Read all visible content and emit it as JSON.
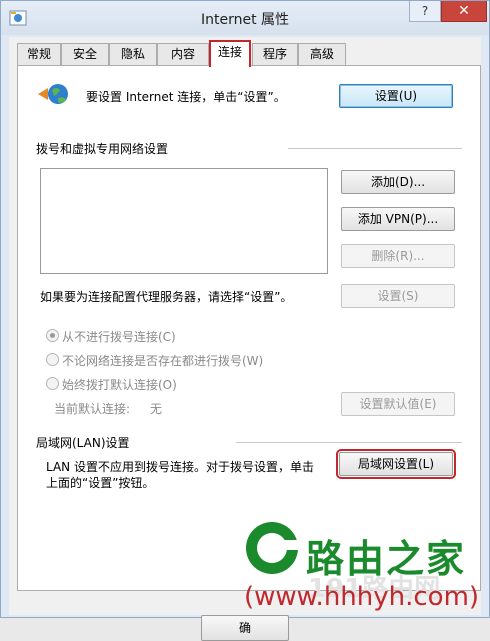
{
  "window": {
    "title": "Internet 属性",
    "help_glyph": "?",
    "close_glyph": "✕"
  },
  "tabs": [
    {
      "label": "常规"
    },
    {
      "label": "安全"
    },
    {
      "label": "隐私"
    },
    {
      "label": "内容"
    },
    {
      "label": "连接",
      "active": true
    },
    {
      "label": "程序"
    },
    {
      "label": "高级"
    }
  ],
  "setup": {
    "text": "要设置 Internet 连接，单击“设置”。",
    "button": "设置(U)"
  },
  "dialup": {
    "heading": "拨号和虚拟专用网络设置",
    "add_button": "添加(D)...",
    "add_vpn_button": "添加 VPN(P)...",
    "remove_button": "删除(R)...",
    "proxy_text": "如果要为连接配置代理服务器，请选择“设置”。",
    "settings_button": "设置(S)",
    "options": [
      {
        "label": "从不进行拨号连接(C)",
        "checked": true
      },
      {
        "label": "不论网络连接是否存在都进行拨号(W)",
        "checked": false
      },
      {
        "label": "始终拨打默认连接(O)",
        "checked": false
      }
    ],
    "current_default_label": "当前默认连接:",
    "current_default_value": "无",
    "set_default_button": "设置默认值(E)"
  },
  "lan": {
    "heading": "局域网(LAN)设置",
    "text_line1": "LAN 设置不应用到拨号连接。对于拨号设置，单击",
    "text_line2": "上面的“设置”按钮。",
    "button": "局域网设置(L)"
  },
  "footer": {
    "ok_partial": "确"
  },
  "watermark": {
    "brand": "路由之家",
    "bg_text": "191路由网",
    "url": "(www.hhhyh.com)"
  },
  "colors": {
    "highlight": "#c0282d",
    "watermark_green": "#1a8a2c",
    "close": "#c7453a"
  }
}
